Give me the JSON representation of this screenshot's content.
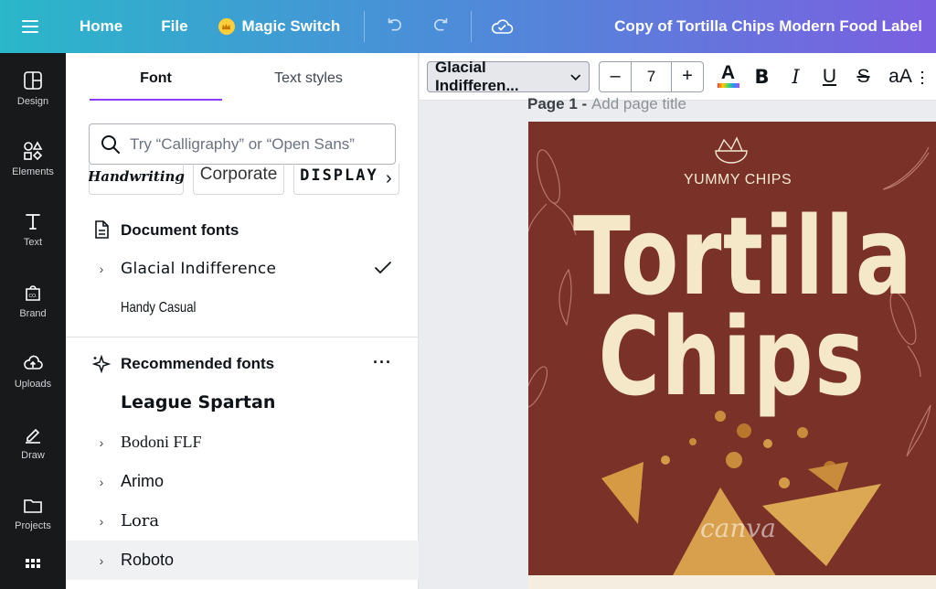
{
  "topbar": {
    "home": "Home",
    "file": "File",
    "magic_switch": "Magic Switch",
    "doc_title": "Copy of Tortilla Chips Modern Food Label"
  },
  "rail": [
    {
      "label": "Design",
      "icon": "design-icon"
    },
    {
      "label": "Elements",
      "icon": "elements-icon"
    },
    {
      "label": "Text",
      "icon": "text-icon"
    },
    {
      "label": "Brand",
      "icon": "brand-icon"
    },
    {
      "label": "Uploads",
      "icon": "uploads-icon"
    },
    {
      "label": "Draw",
      "icon": "draw-icon"
    },
    {
      "label": "Projects",
      "icon": "projects-icon"
    }
  ],
  "panel": {
    "tabs": [
      "Font",
      "Text styles"
    ],
    "search_placeholder": "Try “Calligraphy” or “Open Sans”",
    "chips": [
      "Handwriting",
      "Corporate",
      "DISPLAY"
    ],
    "document_fonts_title": "Document fonts",
    "document_fonts": [
      "Glacial Indifference",
      "Handy Casual"
    ],
    "recommended_title": "Recommended fonts",
    "recommended_fonts": [
      "League Spartan",
      "Bodoni FLF",
      "Arimo",
      "Lora",
      "Roboto"
    ]
  },
  "toolbar": {
    "font_name": "Glacial Indifferen...",
    "font_size": "7",
    "minus": "–",
    "plus": "+",
    "case_label": "aA"
  },
  "canvas": {
    "page_label": "Page 1 -",
    "page_title_placeholder": "Add page title",
    "brand": "YUMMY CHIPS",
    "title_line1": "Tortilla",
    "title_line2": "Chips",
    "watermark": "canva"
  },
  "colors": {
    "accent": "#8b3dff",
    "design_bg": "#7a3128",
    "title_text": "#f5e8c8",
    "rail_bg": "#18191b"
  }
}
